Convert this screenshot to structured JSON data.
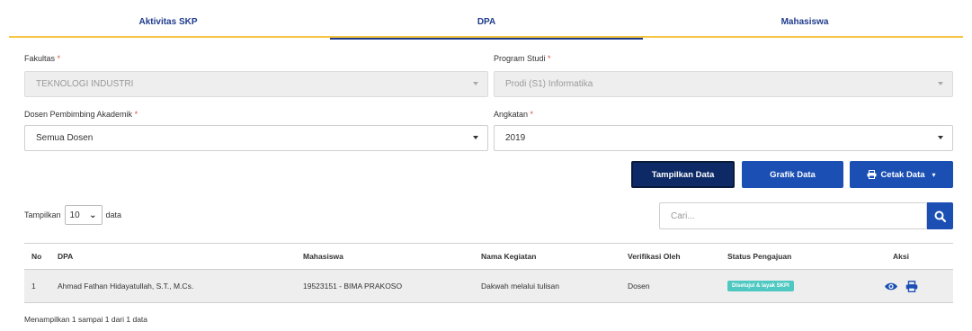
{
  "tabs": [
    {
      "label": "Aktivitas SKP"
    },
    {
      "label": "DPA"
    },
    {
      "label": "Mahasiswa"
    }
  ],
  "active_tab": "DPA",
  "form": {
    "fakultas": {
      "label": "Fakultas",
      "value": "TEKNOLOGI INDUSTRI"
    },
    "prodi": {
      "label": "Program Studi",
      "value": "Prodi (S1) Informatika"
    },
    "dosen": {
      "label": "Dosen Pembimbing Akademik",
      "value": "Semua Dosen"
    },
    "angkatan": {
      "label": "Angkatan",
      "value": "2019"
    },
    "required_mark": "*"
  },
  "buttons": {
    "tampilkan": "Tampilkan Data",
    "grafik": "Grafik Data",
    "cetak": "Cetak Data"
  },
  "table_controls": {
    "show_prefix": "Tampilkan",
    "show_value": "10",
    "show_suffix": "data",
    "search_placeholder": "Cari..."
  },
  "table": {
    "headers": [
      "No",
      "DPA",
      "Mahasiswa",
      "Nama Kegiatan",
      "Verifikasi Oleh",
      "Status Pengajuan",
      "Aksi"
    ],
    "rows": [
      {
        "no": "1",
        "dpa": "Ahmad Fathan Hidayatullah, S.T., M.Cs.",
        "mahasiswa": "19523151 - BIMA PRAKOSO",
        "kegiatan": "Dakwah melalui tulisan",
        "verifikasi": "Dosen",
        "status": "Disetujui & layak SKPI"
      }
    ]
  },
  "info": "Menampilkan 1 sampai 1 dari 1 data",
  "colors": {
    "primary": "#1b4fb3",
    "dark": "#0d2a66",
    "accent_line": "#f5c542",
    "status_badge": "#4ec8c0"
  }
}
